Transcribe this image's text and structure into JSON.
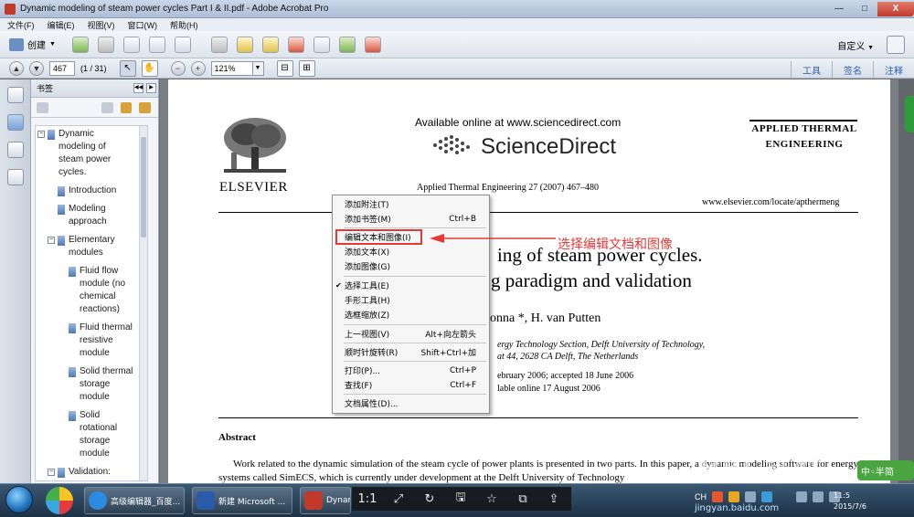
{
  "window": {
    "title": "Dynamic modeling of steam power cycles Part I & II.pdf - Adobe Acrobat Pro",
    "minimize": "—",
    "maximize": "□",
    "close": "X"
  },
  "menu": [
    "文件(F)",
    "编辑(E)",
    "视图(V)",
    "窗口(W)",
    "帮助(H)"
  ],
  "toolbar": {
    "create_label": "创建",
    "custom_label": "自定义",
    "icons": [
      "open-icon",
      "save-icon",
      "print-icon",
      "edit-icon",
      "email-icon",
      "settings-icon",
      "comment-icon",
      "stamp-icon",
      "pdf-tool-icon",
      "export-icon",
      "export2-icon",
      "sign-icon"
    ]
  },
  "nav": {
    "page_value": "467",
    "page_count": "(1 / 31)",
    "zoom_value": "121%",
    "zoom_out": "−",
    "zoom_in": "+",
    "right_links": [
      "工具",
      "签名",
      "注释"
    ]
  },
  "panel": {
    "title": "书签",
    "bookmarks": [
      {
        "label": "Dynamic modeling of steam power cycles.",
        "level": 0,
        "expand": "⊟"
      },
      {
        "label": "Introduction",
        "level": 1,
        "expand": ""
      },
      {
        "label": "Modeling approach",
        "level": 1,
        "expand": ""
      },
      {
        "label": "Elementary modules",
        "level": 1,
        "expand": "⊟"
      },
      {
        "label": "Fluid flow module (no chemical reactions)",
        "level": 2,
        "expand": ""
      },
      {
        "label": "Fluid thermal resistive module",
        "level": 2,
        "expand": ""
      },
      {
        "label": "Solid thermal storage module",
        "level": 2,
        "expand": ""
      },
      {
        "label": "Solid rotational storage module",
        "level": 2,
        "expand": ""
      },
      {
        "label": "Validation:",
        "level": 1,
        "expand": "⊟"
      }
    ]
  },
  "document": {
    "available_online": "Available online at www.sciencedirect.com",
    "sciencedirect": "ScienceDirect",
    "elsevier": "ELSEVIER",
    "journal_ref": "Applied Thermal Engineering 27 (2007) 467–480",
    "journal_title": "Applied Thermal Engineering",
    "journal_url": "www.elsevier.com/locate/apthermeng",
    "title_line1": "ing of steam power cycles.",
    "title_line2": "g paradigm and validation",
    "authors": "onna *, H. van Putten",
    "affil1": "ergy Technology Section, Delft University of Technology,",
    "affil2": "at 44, 2628 CA Delft, The Netherlands",
    "dates1": "ebruary 2006; accepted 18 June 2006",
    "dates2": "lable online 17 August 2006",
    "abstract_heading": "Abstract",
    "abstract_text": "Work related to the dynamic simulation of the steam cycle of power plants is presented in two parts. In this paper, a dynamic modeling software for energy systems called SimECS, which is currently under development at the Delft University of Technology"
  },
  "context_menu": {
    "items": [
      {
        "label": "添加附注(T)",
        "shortcut": "",
        "checked": false
      },
      {
        "label": "添加书签(M)",
        "shortcut": "Ctrl+B",
        "checked": false
      },
      {
        "label": "编辑文本和图像(I)",
        "shortcut": "",
        "checked": false
      },
      {
        "label": "添加文本(X)",
        "shortcut": "",
        "checked": false
      },
      {
        "label": "添加图像(G)",
        "shortcut": "",
        "checked": false
      },
      {
        "label": "选择工具(E)",
        "shortcut": "",
        "checked": true
      },
      {
        "label": "手形工具(H)",
        "shortcut": "",
        "checked": false
      },
      {
        "label": "选框缩放(Z)",
        "shortcut": "",
        "checked": false
      },
      {
        "label": "上一视图(V)",
        "shortcut": "Alt+向左箭头",
        "checked": false
      },
      {
        "label": "顺时针旋转(R)",
        "shortcut": "Shift+Ctrl+加",
        "checked": false
      },
      {
        "label": "打印(P)...",
        "shortcut": "Ctrl+P",
        "checked": false
      },
      {
        "label": "查找(F)",
        "shortcut": "Ctrl+F",
        "checked": false
      },
      {
        "label": "文档属性(D)...",
        "shortcut": "",
        "checked": false
      }
    ],
    "check_mark": "✔"
  },
  "annotation": {
    "text": "选择编辑文档和图像",
    "color": "#e53935"
  },
  "taskbar": {
    "apps": [
      "高级编辑器_百度...",
      "新建 Microsoft ...",
      "Dynamic m..."
    ],
    "overlay": [
      "1:1",
      "⤢",
      "↻",
      "🖫",
      "☆",
      "⧉",
      "⇪"
    ],
    "tray_text": "CH",
    "clock_time": "11:5",
    "clock_date": "2015/7/6",
    "watermark": "Bai 经验",
    "watermark_sub": "jingyan.baidu.com",
    "ime": "中◦半简"
  }
}
